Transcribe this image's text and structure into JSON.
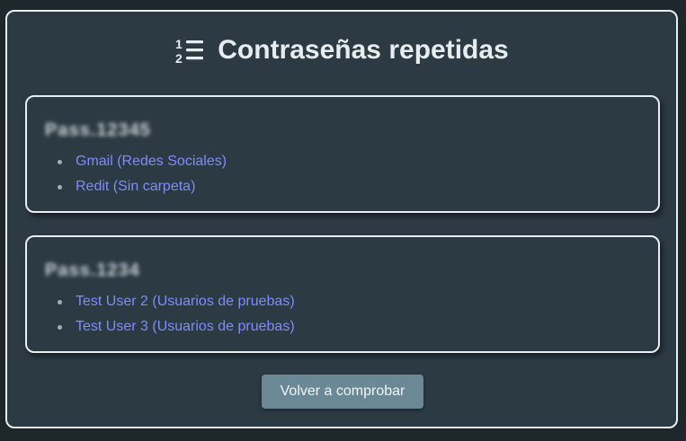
{
  "header": {
    "title": "Contraseñas repetidas",
    "icon": "numbered-list-icon"
  },
  "groups": [
    {
      "password": "Pass.12345",
      "entries": [
        {
          "label": "Gmail (Redes Sociales)"
        },
        {
          "label": "Redit (Sin carpeta)"
        }
      ]
    },
    {
      "password": "Pass.1234",
      "entries": [
        {
          "label": "Test User 2 (Usuarios de pruebas)"
        },
        {
          "label": "Test User 3 (Usuarios de pruebas)"
        }
      ]
    }
  ],
  "actions": {
    "recheck_label": "Volver a comprobar"
  },
  "colors": {
    "background": "#2b3a43",
    "border": "#e9eef0",
    "link": "#7e8cff",
    "button": "#6a8896"
  }
}
